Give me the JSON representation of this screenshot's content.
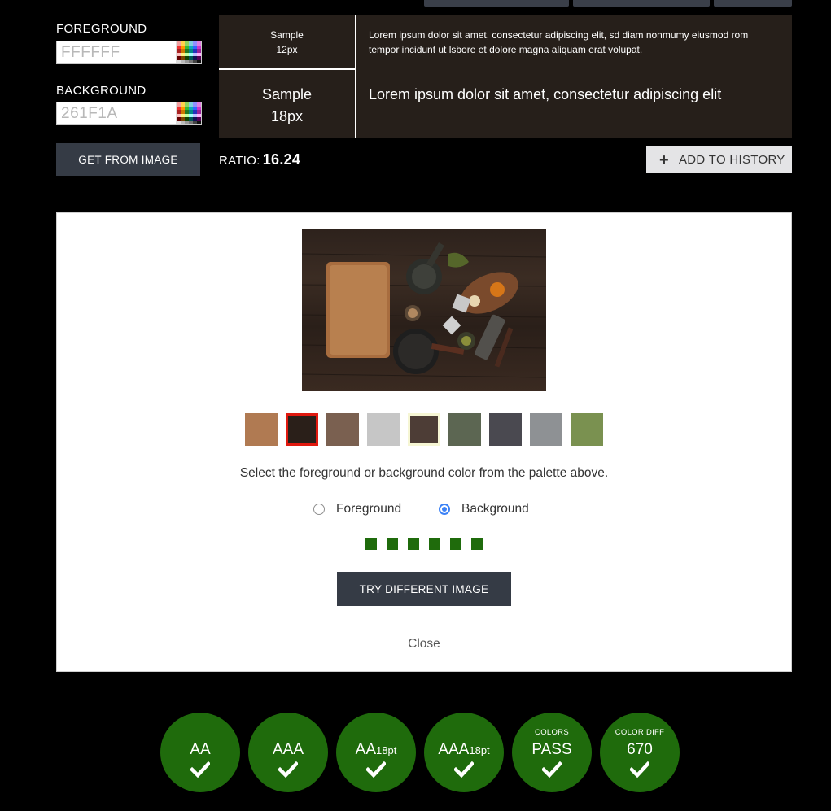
{
  "foreground": {
    "label": "FOREGROUND",
    "value": "FFFFFF"
  },
  "background": {
    "label": "BACKGROUND",
    "value": "261F1A"
  },
  "get_from_image_label": "GET FROM IMAGE",
  "preview": {
    "small_label": "Sample",
    "small_size": "12px",
    "large_label": "Sample",
    "large_size": "18px",
    "small_text": "Lorem ipsum dolor sit amet, consectetur adipiscing elit, sd diam nonmumy eiusmod rom tempor incidunt ut lsbore et dolore magna aliquam erat volupat.",
    "large_text": "Lorem ipsum dolor sit amet, consectetur adipiscing elit",
    "bg_color": "#261f1a",
    "fg_color": "#ffffff"
  },
  "ratio": {
    "label": "RATIO:",
    "value": "16.24"
  },
  "add_to_history_label": "ADD TO HISTORY",
  "image_panel": {
    "palette": [
      "#b07a52",
      "#2a1f19",
      "#7a6050",
      "#c6c6c6",
      "#4d3d36",
      "#5c6652",
      "#4a4950",
      "#8e9194",
      "#7a9150"
    ],
    "selected_foreground_index": 1,
    "selected_background_index": 4,
    "instructions": "Select the foreground or background color from the palette above.",
    "radio_foreground_label": "Foreground",
    "radio_background_label": "Background",
    "selected_mode": "Background",
    "progress_dots": 6,
    "try_different_label": "TRY DIFFERENT IMAGE",
    "close_label": "Close"
  },
  "results": [
    {
      "label": "AA",
      "suffix": "",
      "status": "pass"
    },
    {
      "label": "AAA",
      "suffix": "",
      "status": "pass"
    },
    {
      "label": "AA",
      "suffix": "18pt",
      "status": "pass"
    },
    {
      "label": "AAA",
      "suffix": "18pt",
      "status": "pass"
    },
    {
      "title": "COLORS",
      "value": "PASS",
      "status": "pass"
    },
    {
      "title": "COLOR DIFF",
      "value": "670",
      "status": "pass"
    }
  ],
  "colors": {
    "pass_green": "#1f6b0c",
    "accent_blue": "#3c82f6",
    "button_dark": "#353b45"
  }
}
